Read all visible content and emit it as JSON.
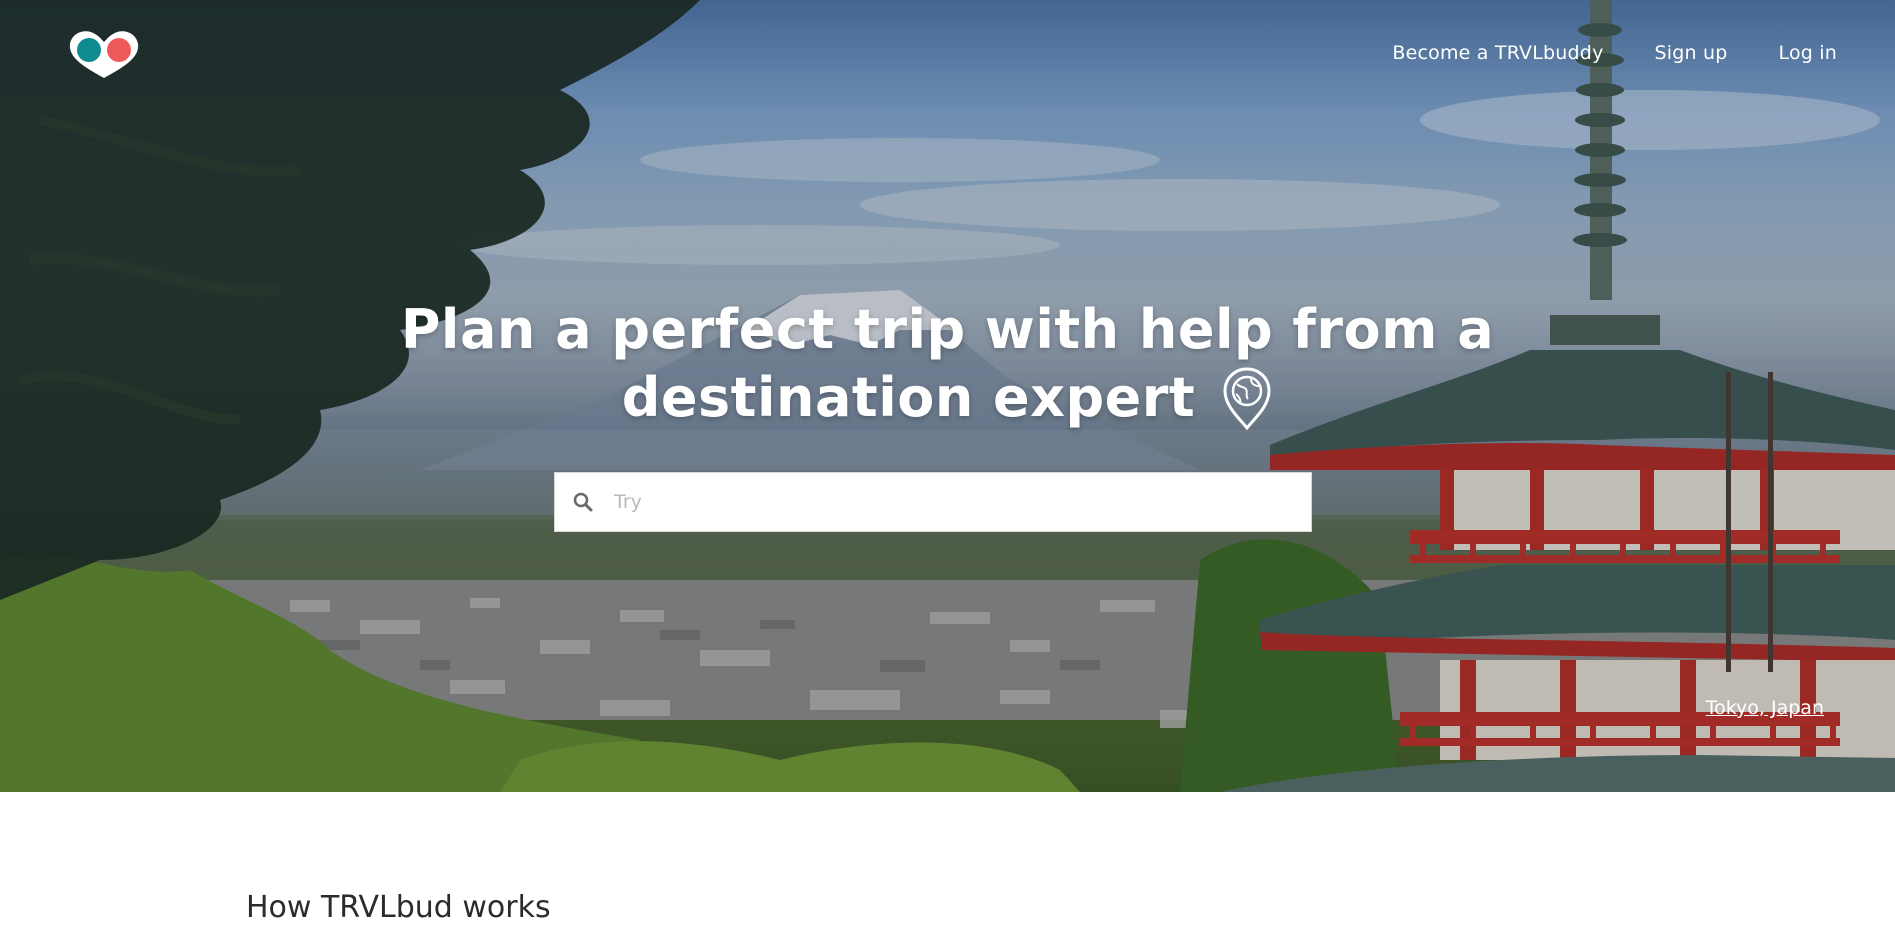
{
  "brand": {
    "logo_icon": "trvlbud-heart-logo-icon",
    "colors": {
      "teal": "#0f8a8f",
      "coral": "#f0595c"
    }
  },
  "nav": {
    "become_buddy": "Become a TRVLbuddy",
    "sign_up": "Sign up",
    "log_in": "Log in"
  },
  "hero": {
    "headline_line1": "Plan a perfect trip with help from a",
    "headline_line2": "destination expert",
    "expert_icon": "globe-pin-icon",
    "search": {
      "icon": "search-icon",
      "placeholder": "Try",
      "value": ""
    },
    "photo_location": "Tokyo, Japan"
  },
  "how_it_works": {
    "heading": "How TRVLbud works"
  }
}
